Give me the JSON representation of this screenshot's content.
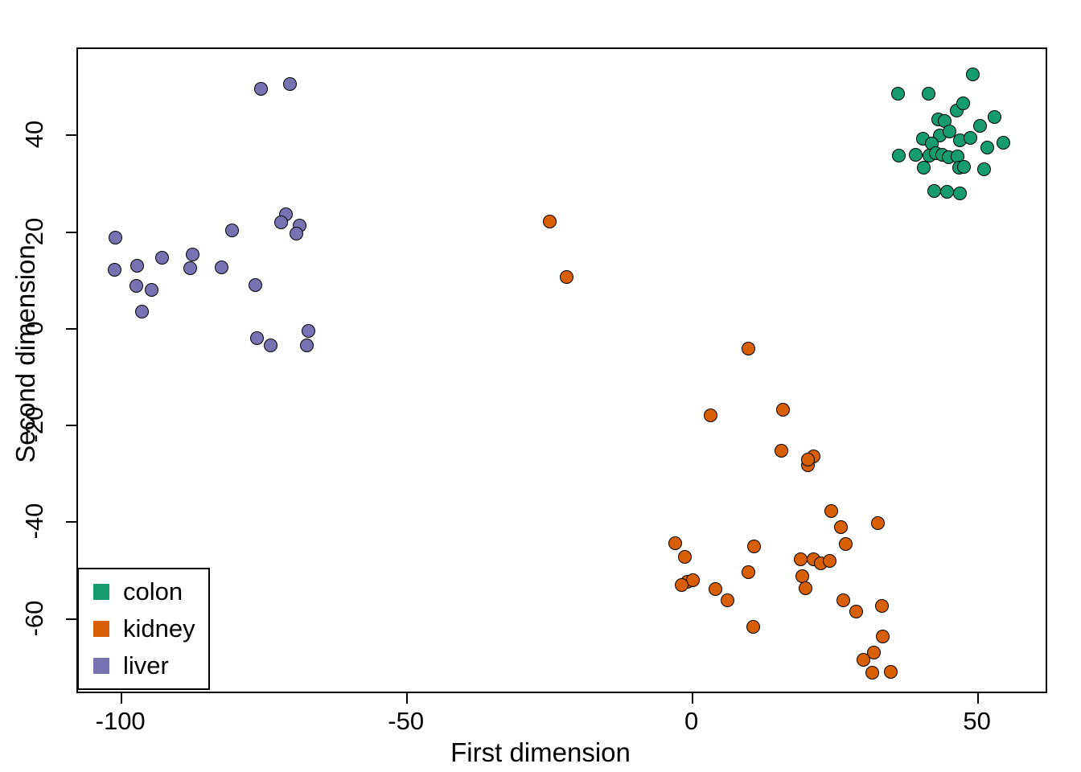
{
  "chart_data": {
    "type": "scatter",
    "title": "",
    "xlabel": "First dimension",
    "ylabel": "Second dimension",
    "xlim": [
      -107.7,
      62.3
    ],
    "ylim": [
      -75.5,
      58.0
    ],
    "xticks": [
      -100,
      -50,
      0,
      50
    ],
    "xticklabels": [
      "-100",
      "-50",
      "0",
      "50"
    ],
    "yticks": [
      -60,
      -40,
      -20,
      0,
      20,
      40
    ],
    "yticklabels": [
      "-60",
      "-40",
      "-20",
      "0",
      "20",
      "40"
    ],
    "grid": false,
    "legend_position": "bottom-left",
    "marker": "filled-circle-black-edge",
    "series": [
      {
        "name": "colon",
        "color": "#179C6F",
        "points": [
          [
            49.0,
            52.8
          ],
          [
            35.9,
            48.8
          ],
          [
            41.3,
            48.7
          ],
          [
            43.0,
            43.5
          ],
          [
            44.0,
            43.2
          ],
          [
            46.2,
            45.3
          ],
          [
            47.3,
            46.8
          ],
          [
            43.2,
            40.2
          ],
          [
            44.9,
            41.0
          ],
          [
            50.3,
            42.2
          ],
          [
            52.8,
            43.9
          ],
          [
            40.3,
            39.5
          ],
          [
            41.8,
            38.4
          ],
          [
            46.8,
            39.2
          ],
          [
            48.6,
            39.6
          ],
          [
            39.0,
            36.2
          ],
          [
            41.4,
            36.0
          ],
          [
            42.5,
            36.5
          ],
          [
            43.6,
            36.1
          ],
          [
            44.8,
            35.6
          ],
          [
            46.3,
            35.8
          ],
          [
            51.5,
            37.7
          ],
          [
            54.3,
            38.6
          ],
          [
            40.4,
            33.4
          ],
          [
            46.6,
            33.4
          ],
          [
            47.4,
            33.6
          ],
          [
            50.9,
            33.2
          ],
          [
            42.2,
            28.6
          ],
          [
            44.5,
            28.5
          ],
          [
            46.8,
            28.1
          ],
          [
            36.0,
            35.9
          ]
        ]
      },
      {
        "name": "kidney",
        "color": "#D95F06",
        "points": [
          [
            -25.1,
            22.3
          ],
          [
            -22.1,
            10.8
          ],
          [
            9.7,
            -4.0
          ],
          [
            3.1,
            -17.7
          ],
          [
            15.8,
            -16.5
          ],
          [
            15.5,
            -25.0
          ],
          [
            20.1,
            -28.0
          ],
          [
            21.1,
            -26.2
          ],
          [
            20.1,
            -26.8
          ],
          [
            24.2,
            -37.5
          ],
          [
            25.9,
            -40.8
          ],
          [
            32.4,
            -40.0
          ],
          [
            26.8,
            -44.3
          ],
          [
            -3.1,
            -44.2
          ],
          [
            -1.5,
            -47.0
          ],
          [
            10.7,
            -44.8
          ],
          [
            9.7,
            -50.2
          ],
          [
            -1.0,
            -52.2
          ],
          [
            0.0,
            -51.8
          ],
          [
            -2.0,
            -52.8
          ],
          [
            3.9,
            -53.7
          ],
          [
            6.1,
            -56.0
          ],
          [
            18.9,
            -47.5
          ],
          [
            21.1,
            -47.5
          ],
          [
            22.3,
            -48.3
          ],
          [
            23.9,
            -47.8
          ],
          [
            19.2,
            -51.0
          ],
          [
            19.7,
            -53.5
          ],
          [
            10.6,
            -61.5
          ],
          [
            26.3,
            -56.0
          ],
          [
            28.5,
            -58.3
          ],
          [
            33.1,
            -57.2
          ],
          [
            33.2,
            -63.5
          ],
          [
            31.7,
            -66.7
          ],
          [
            29.9,
            -68.2
          ],
          [
            31.4,
            -71.0
          ],
          [
            34.6,
            -70.7
          ]
        ]
      },
      {
        "name": "liver",
        "color": "#7972B2",
        "points": [
          [
            -75.6,
            49.8
          ],
          [
            -70.6,
            50.7
          ],
          [
            -71.3,
            23.8
          ],
          [
            -72.1,
            22.2
          ],
          [
            -68.9,
            21.5
          ],
          [
            -69.5,
            19.8
          ],
          [
            -80.7,
            20.5
          ],
          [
            -101.1,
            19.0
          ],
          [
            -93.0,
            14.8
          ],
          [
            -97.3,
            13.2
          ],
          [
            -101.3,
            12.3
          ],
          [
            -87.7,
            15.5
          ],
          [
            -88.0,
            12.7
          ],
          [
            -82.5,
            12.8
          ],
          [
            -97.5,
            9.0
          ],
          [
            -94.8,
            8.2
          ],
          [
            -96.5,
            3.7
          ],
          [
            -76.6,
            9.2
          ],
          [
            -76.3,
            -1.7
          ],
          [
            -73.9,
            -3.3
          ],
          [
            -67.3,
            -0.3
          ],
          [
            -67.7,
            -3.2
          ]
        ]
      }
    ]
  },
  "legend": {
    "entries": [
      {
        "label": "colon",
        "color": "#179C6F"
      },
      {
        "label": "kidney",
        "color": "#D95F06"
      },
      {
        "label": "liver",
        "color": "#7972B2"
      }
    ]
  }
}
